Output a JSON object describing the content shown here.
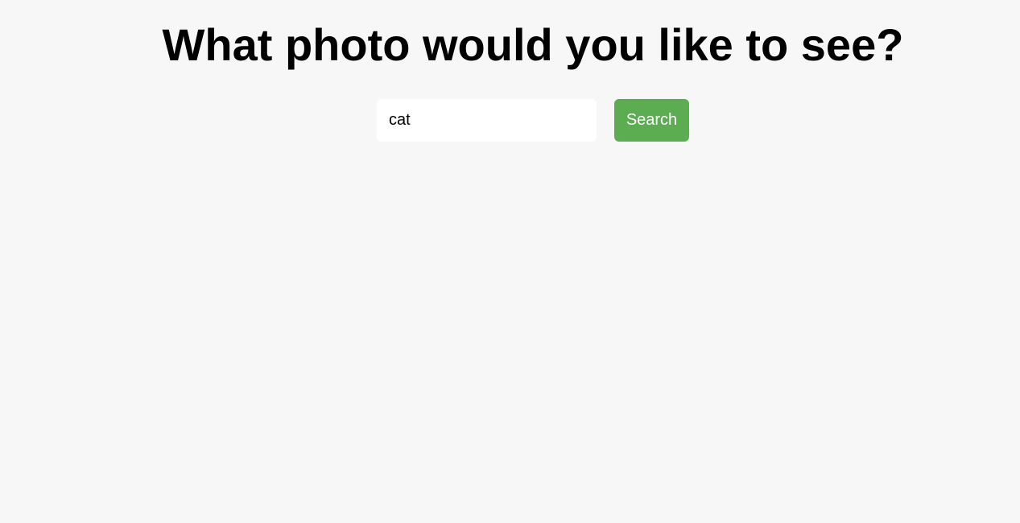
{
  "header": {
    "title": "What photo would you like to see?"
  },
  "search": {
    "value": "cat",
    "placeholder": "",
    "button_label": "Search"
  },
  "colors": {
    "background": "#f7f7f7",
    "button": "#5cad52",
    "button_text": "#ffffff",
    "input_background": "#ffffff"
  }
}
